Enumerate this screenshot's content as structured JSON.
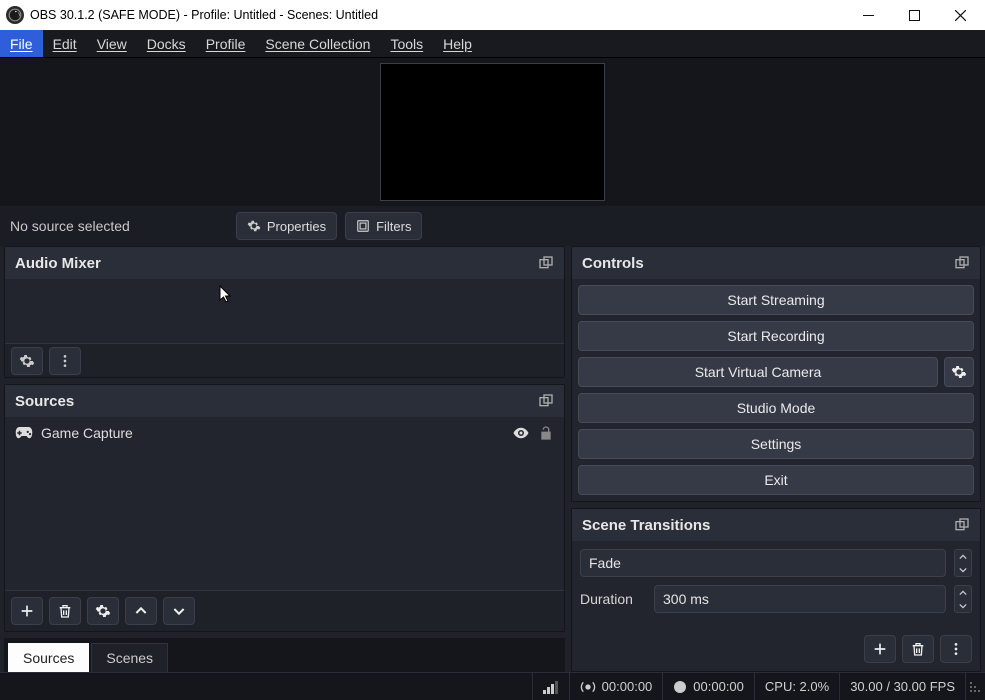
{
  "window": {
    "title": "OBS 30.1.2 (SAFE MODE) - Profile: Untitled - Scenes: Untitled"
  },
  "menu": {
    "file": "File",
    "edit": "Edit",
    "view": "View",
    "docks": "Docks",
    "profile": "Profile",
    "scene_collection": "Scene Collection",
    "tools": "Tools",
    "help": "Help"
  },
  "source_toolbar": {
    "status": "No source selected",
    "properties": "Properties",
    "filters": "Filters"
  },
  "audio_mixer": {
    "title": "Audio Mixer"
  },
  "sources_panel": {
    "title": "Sources",
    "items": [
      {
        "name": "Game Capture",
        "visible": true,
        "locked": false
      }
    ]
  },
  "tabs": {
    "sources": "Sources",
    "scenes": "Scenes"
  },
  "controls": {
    "title": "Controls",
    "start_streaming": "Start Streaming",
    "start_recording": "Start Recording",
    "start_virtual_cam": "Start Virtual Camera",
    "studio_mode": "Studio Mode",
    "settings": "Settings",
    "exit": "Exit"
  },
  "transitions": {
    "title": "Scene Transitions",
    "selected": "Fade",
    "duration_label": "Duration",
    "duration_value": "300 ms"
  },
  "status": {
    "live_time": "00:00:00",
    "rec_time": "00:00:00",
    "cpu": "CPU: 2.0%",
    "fps": "30.00 / 30.00 FPS"
  }
}
